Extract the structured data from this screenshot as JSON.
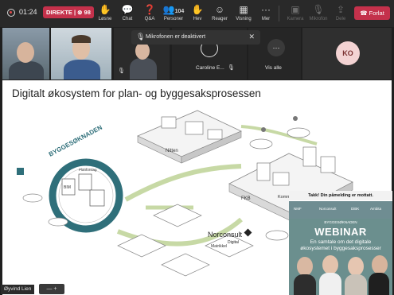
{
  "topbar": {
    "timer": "01:24",
    "live_badge": "DIREKTE | ⊗ 98",
    "tools": [
      {
        "label": "Løsne",
        "icon": "hand-icon"
      },
      {
        "label": "Chat",
        "icon": "chat-icon"
      },
      {
        "label": "Q&A",
        "icon": "qa-icon"
      },
      {
        "label": "Personer",
        "icon": "people-icon",
        "count": "104"
      },
      {
        "label": "Hev",
        "icon": "raise-hand-icon"
      },
      {
        "label": "Reager",
        "icon": "react-icon"
      },
      {
        "label": "Visning",
        "icon": "view-icon"
      },
      {
        "label": "Mer",
        "icon": "more-icon"
      },
      {
        "label": "Kamera",
        "icon": "camera-icon",
        "disabled": true
      },
      {
        "label": "Mikrofon",
        "icon": "microphone-icon",
        "disabled": true
      },
      {
        "label": "Dele",
        "icon": "share-icon",
        "disabled": true
      }
    ],
    "leave_label": "Forlat"
  },
  "toast": {
    "text": "Mikrofonen er deaktivert"
  },
  "participants": {
    "caroline_label": "Caroline E...",
    "see_all_label": "Vis alle",
    "ko_initials": "KO"
  },
  "slide": {
    "title": "Digitalt økosystem for plan- og byggesaksprosessen",
    "labels": {
      "byggesoknaden": "BYGGESØKNADEN",
      "nitten": "Nitten",
      "fkb": "FKB",
      "norconsult": "Norconsult",
      "digital": "Digital",
      "matrikkel": "Matrikkel",
      "kommune": "Kommune",
      "bim": "BIM",
      "planforslag": "Planforslag"
    }
  },
  "presenter": {
    "name": "Øyvind Lien",
    "mini_controls": "— +"
  },
  "webinar_card": {
    "top_text": "Takk! Din påmelding er mottatt.",
    "logos": [
      "NMF",
      "Norconsult",
      "DiBK",
      "Ambita"
    ],
    "brand": "BYGGESØKNADEN",
    "headline": "WEBINAR",
    "subline1": "En samtale om det digitale",
    "subline2": "økosystemet i byggesaksprosesser"
  },
  "colors": {
    "topbar_bg": "#292929",
    "leave_button": "#c4314b",
    "live_badge": "#c4314b",
    "webinar_bg": "#6b8f8e",
    "diagram_accent": "#2f6f7a"
  }
}
